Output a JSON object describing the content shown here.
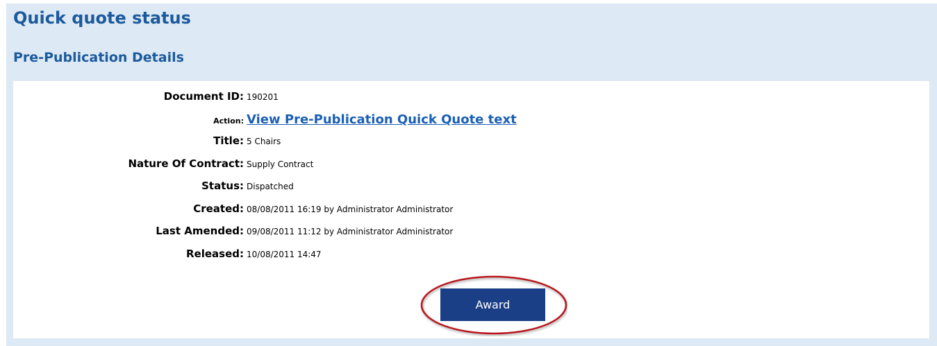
{
  "page_title": "Quick quote status",
  "section_title": "Pre-Publication Details",
  "details": {
    "document_id": {
      "label": "Document ID:",
      "value": "190201"
    },
    "action": {
      "label": "Action:",
      "value": "View Pre-Publication Quick Quote text"
    },
    "title": {
      "label": "Title:",
      "value": "5 Chairs"
    },
    "nature_of_contract": {
      "label": "Nature Of Contract:",
      "value": "Supply Contract"
    },
    "status": {
      "label": "Status:",
      "value": "Dispatched"
    },
    "created": {
      "label": "Created:",
      "value": "08/08/2011 16:19 by Administrator Administrator"
    },
    "last_amended": {
      "label": "Last Amended:",
      "value": "09/08/2011 11:12 by Administrator Administrator"
    },
    "released": {
      "label": "Released:",
      "value": "10/08/2011 14:47"
    }
  },
  "award_button": {
    "label": "Award"
  },
  "colors": {
    "heading": "#1b5a9c",
    "background": "#dde9f4",
    "button": "#1a3f86",
    "link": "#1a5fb4",
    "highlight": "#b8171c"
  }
}
